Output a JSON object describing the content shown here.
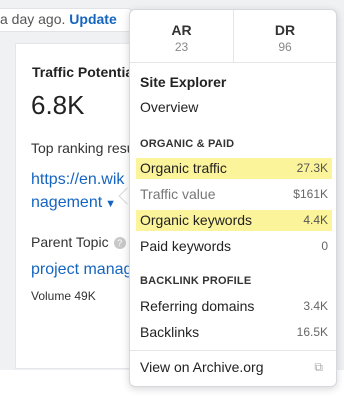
{
  "background": {
    "updated_lead": "a day ago.",
    "updated_link": "Update",
    "traffic_title": "Traffic Potential",
    "traffic_value": "6.8K",
    "top_ranking_label": "Top ranking result",
    "url_line1": "https://en.wik",
    "url_line2": "nagement",
    "parent_topic_label": "Parent Topic",
    "parent_topic_link": "project manag",
    "volume": "Volume 49K"
  },
  "popover": {
    "metrics": [
      {
        "label": "AR",
        "value": "23"
      },
      {
        "label": "DR",
        "value": "96"
      }
    ],
    "title": "Site Explorer",
    "overview": "Overview",
    "organic_caption": "ORGANIC & PAID",
    "organic_rows": [
      {
        "label": "Organic traffic",
        "value": "27.3K",
        "highlighted": true
      },
      {
        "label": "Traffic value",
        "value": "$161K",
        "highlighted": false
      },
      {
        "label": "Organic keywords",
        "value": "4.4K",
        "highlighted": true
      },
      {
        "label": "Paid keywords",
        "value": "0",
        "highlighted": false
      }
    ],
    "backlink_caption": "BACKLINK PROFILE",
    "backlink_rows": [
      {
        "label": "Referring domains",
        "value": "3.4K"
      },
      {
        "label": "Backlinks",
        "value": "16.5K"
      }
    ],
    "archive_link": "View on Archive.org"
  },
  "colors": {
    "link": "#1565c0",
    "highlight": "#fcf49a"
  },
  "icons": [
    "question-icon",
    "chevron-down-icon",
    "external-link-icon"
  ]
}
